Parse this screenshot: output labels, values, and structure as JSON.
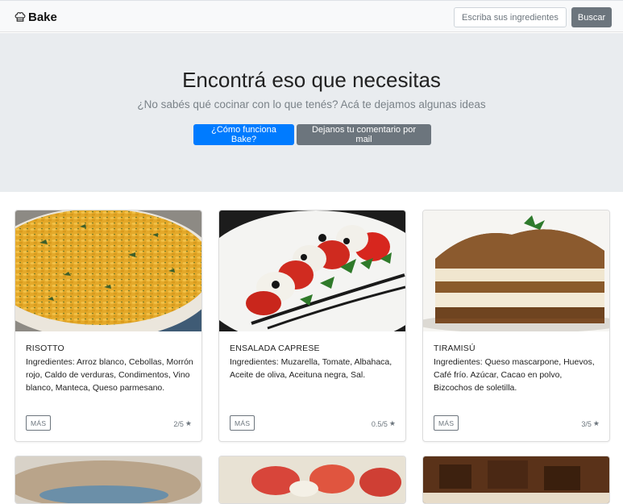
{
  "navbar": {
    "brand": "Bake",
    "brand_icon": "chef-hat-icon",
    "search_placeholder": "Escriba sus ingredientes",
    "search_button": "Buscar"
  },
  "hero": {
    "title": "Encontrá eso que necesitas",
    "subtitle": "¿No sabés qué cocinar con lo que tenés? Acá te dejamos algunas ideas",
    "primary_button": "¿Cómo funciona Bake?",
    "secondary_button": "Dejanos tu comentario por mail"
  },
  "colors": {
    "primary": "#007bff",
    "secondary": "#6c757d",
    "hero_bg": "#e9ecef",
    "navbar_bg": "#f8f9fa"
  },
  "recipes": [
    {
      "title": "RISOTTO",
      "ingredients": "Ingredientes: Arroz blanco, Cebollas, Morrón rojo, Caldo de verduras, Condimentos, Vino blanco, Manteca, Queso parmesano.",
      "more_label": "MÁS",
      "rating": "2/5",
      "image": "risotto-photo"
    },
    {
      "title": "ENSALADA CAPRESE",
      "ingredients": "Ingredientes: Muzarella, Tomate, Albahaca, Aceite de oliva, Aceituna negra, Sal.",
      "more_label": "MÁS",
      "rating": "0.5/5",
      "image": "caprese-photo"
    },
    {
      "title": "TIRAMISÚ",
      "ingredients": "Ingredientes: Queso mascarpone, Huevos, Café frío. Azúcar, Cacao en polvo, Bizcochos de soletilla.",
      "more_label": "MÁS",
      "rating": "3/5",
      "image": "tiramisu-photo"
    }
  ],
  "rating_icon": "star-icon"
}
